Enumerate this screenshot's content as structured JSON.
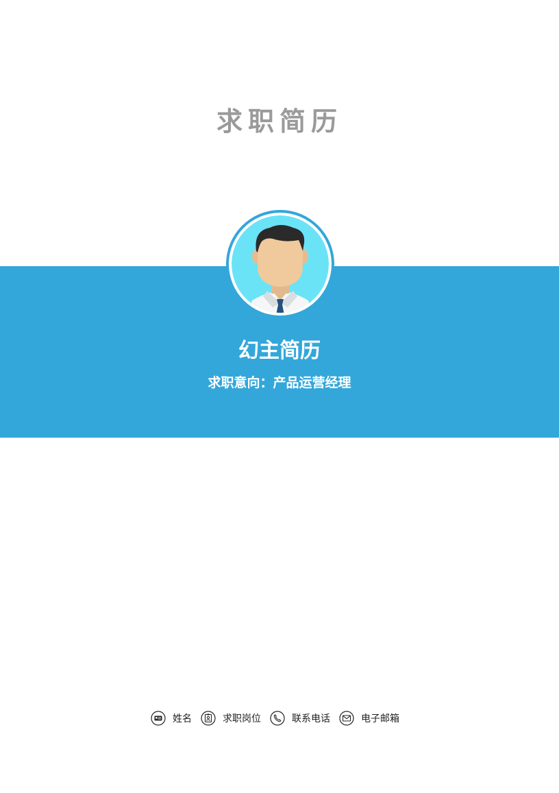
{
  "title": "求职简历",
  "profile": {
    "name": "幻主简历",
    "intent": "求职意向：产品运营经理"
  },
  "colors": {
    "banner": "#33a7da",
    "title": "#9a9a9a",
    "avatar_bg": "#6ae3f7"
  },
  "contact": {
    "items": [
      {
        "icon": "id-card-icon",
        "label": "姓名"
      },
      {
        "icon": "badge-icon",
        "label": "求职岗位"
      },
      {
        "icon": "phone-icon",
        "label": "联系电话"
      },
      {
        "icon": "envelope-icon",
        "label": "电子邮箱"
      }
    ]
  }
}
